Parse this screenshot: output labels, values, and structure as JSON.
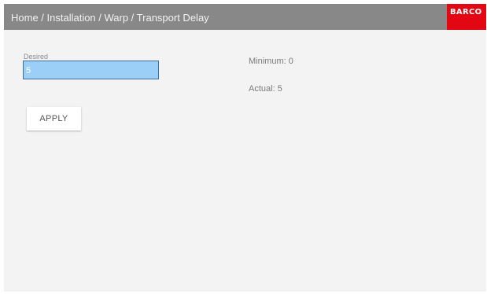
{
  "header": {
    "breadcrumb": "Home / Installation / Warp / Transport Delay",
    "logo_text": "BARCO"
  },
  "form": {
    "desired_label": "Desired",
    "desired_value": "5",
    "minimum_text": "Minimum: 0",
    "actual_text": "Actual: 5",
    "apply_label": "APPLY"
  },
  "colors": {
    "header_bg": "#888888",
    "logo_bg": "#e30613",
    "input_bg": "#9ccff7",
    "page_bg": "#f3f3f3"
  }
}
